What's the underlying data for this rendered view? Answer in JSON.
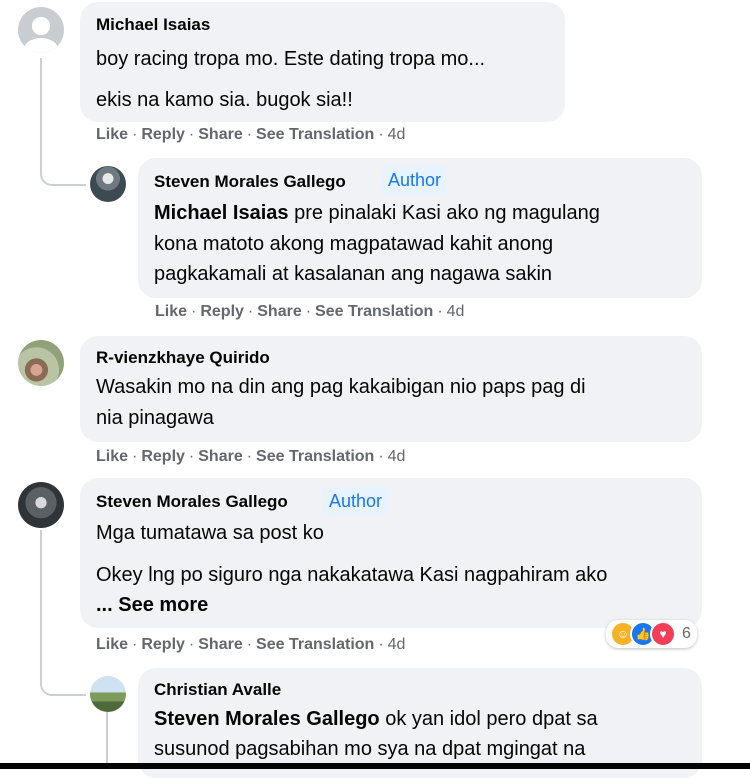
{
  "actions": {
    "like": "Like",
    "reply": "Reply",
    "share": "Share",
    "translate": "See Translation",
    "sep": "·"
  },
  "comments": [
    {
      "author": "Michael Isaias",
      "lines": [
        "boy racing tropa mo. Este dating tropa mo...",
        "ekis na kamo sia. bugok sia!!"
      ],
      "time": "4d"
    },
    {
      "author": "Steven Morales Gallego",
      "badge": "Author",
      "mention": "Michael Isaias",
      "lines": [
        " pre pinalaki Kasi ako ng magulang",
        "kona matoto akong magpatawad kahit anong",
        "pagkakamali at kasalanan ang nagawa sakin"
      ],
      "time": "4d"
    },
    {
      "author": "R-vienzkhaye Quirido",
      "lines": [
        "Wasakin mo na din ang pag kakaibigan nio paps pag di",
        "nia pinagawa"
      ],
      "time": "4d"
    },
    {
      "author": "Steven Morales Gallego",
      "badge": "Author",
      "lines": [
        "Mga tumatawa sa post ko",
        "Okey lng po siguro nga nakakatawa Kasi nagpahiram ako"
      ],
      "see_more": "... See more",
      "reaction_count": "6",
      "reaction_icons": [
        "care-icon",
        "like-icon",
        "love-icon"
      ],
      "time": "4d"
    },
    {
      "author": "Christian Avalle",
      "mention": "Steven Morales Gallego",
      "lines": [
        " ok yan idol pero dpat sa",
        "susunod pagsabihan mo sya na dpat mgingat na"
      ]
    }
  ]
}
